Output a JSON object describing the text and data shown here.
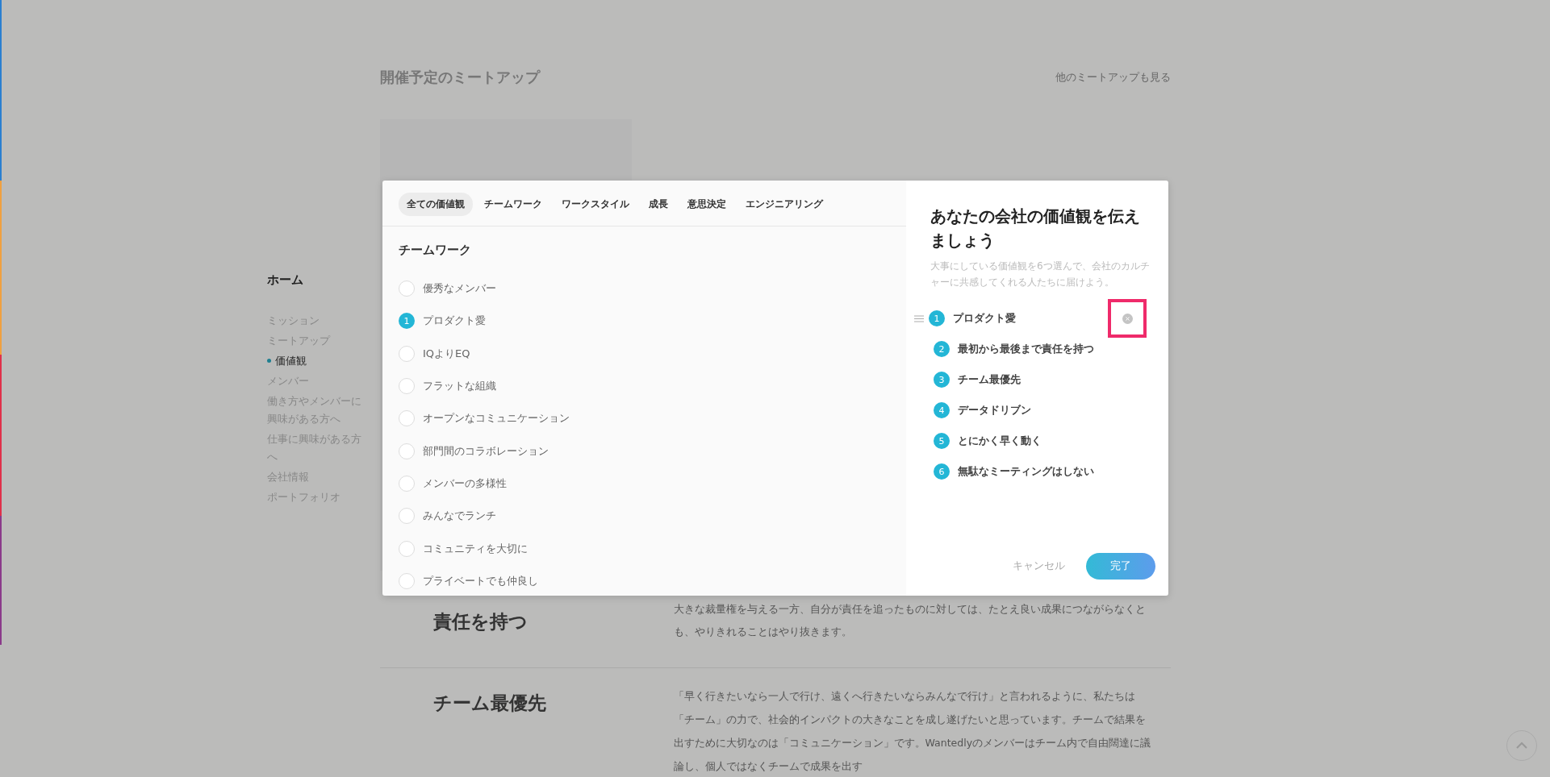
{
  "page": {
    "meetup_title": "開催予定のミートアップ",
    "meetup_link": "他のミートアップも見る"
  },
  "sidebar": {
    "title": "ホーム",
    "items": [
      {
        "label": "ミッション",
        "selected": false
      },
      {
        "label": "ミートアップ",
        "selected": false
      },
      {
        "label": "価値観",
        "selected": true
      },
      {
        "label": "メンバー",
        "selected": false
      },
      {
        "label": "働き方やメンバーに興味がある方へ",
        "selected": false
      },
      {
        "label": "仕事に興味がある方へ",
        "selected": false
      },
      {
        "label": "会社情報",
        "selected": false
      },
      {
        "label": "ポートフォリオ",
        "selected": false
      }
    ]
  },
  "sections": [
    {
      "heading": "責任を持つ",
      "text": "大きな裁量権を与える一方、自分が責任を追ったものに対しては、たとえ良い成果につながらなくとも、やりきれることはやり抜きます。"
    },
    {
      "heading": "チーム最優先",
      "text": "「早く行きたいなら一人で行け、遠くへ行きたいならみんなで行け」と言われるように、私たちは「チーム」の力で、社会的インパクトの大きなことを成し遂げたいと思っています。チームで結果を出すために大切なのは「コミュニケーション」です。Wantedlyのメンバーはチーム内で自由闊達に議論し、個人ではなくチームで成果を出す"
    }
  ],
  "modal": {
    "tabs": [
      {
        "label": "全ての価値観",
        "selected": true
      },
      {
        "label": "チームワーク",
        "selected": false
      },
      {
        "label": "ワークスタイル",
        "selected": false
      },
      {
        "label": "成長",
        "selected": false
      },
      {
        "label": "意思決定",
        "selected": false
      },
      {
        "label": "エンジニアリング",
        "selected": false
      }
    ],
    "category": "チームワーク",
    "values": [
      {
        "label": "優秀なメンバー",
        "selected": false
      },
      {
        "label": "プロダクト愛",
        "selected": true,
        "rank": "1"
      },
      {
        "label": "IQよりEQ",
        "selected": false
      },
      {
        "label": "フラットな組織",
        "selected": false
      },
      {
        "label": "オープンなコミュニケーション",
        "selected": false
      },
      {
        "label": "部門間のコラボレーション",
        "selected": false
      },
      {
        "label": "メンバーの多様性",
        "selected": false
      },
      {
        "label": "みんなでランチ",
        "selected": false
      },
      {
        "label": "コミュニティを大切に",
        "selected": false
      },
      {
        "label": "プライベートでも仲良し",
        "selected": false
      }
    ],
    "title": "あなたの会社の価値観を伝えましょう",
    "description": "大事にしている価値観を6つ選んで、会社のカルチャーに共感してくれる人たちに届けよう。",
    "chosen": [
      {
        "rank": "1",
        "label": "プロダクト愛",
        "hovered": true
      },
      {
        "rank": "2",
        "label": "最初から最後まで責任を持つ",
        "hovered": false
      },
      {
        "rank": "3",
        "label": "チーム最優先",
        "hovered": false
      },
      {
        "rank": "4",
        "label": "データドリブン",
        "hovered": false
      },
      {
        "rank": "5",
        "label": "とにかく早く動く",
        "hovered": false
      },
      {
        "rank": "6",
        "label": "無駄なミーティングはしない",
        "hovered": false
      }
    ],
    "cancel": "キャンセル",
    "done": "完了"
  }
}
